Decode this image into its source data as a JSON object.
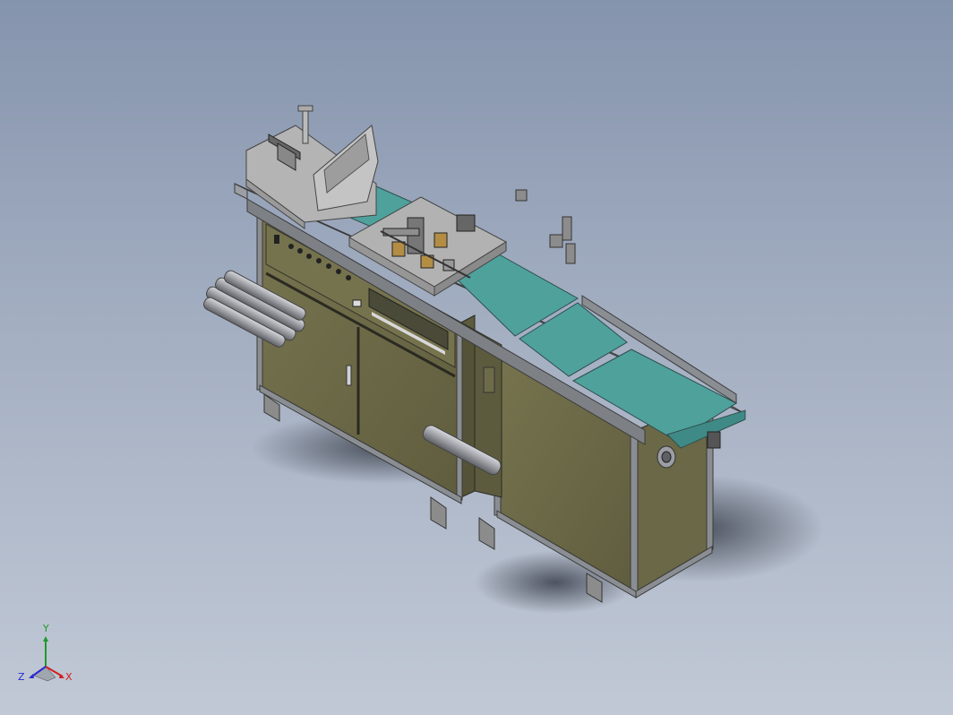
{
  "viewport": {
    "background_top": "#8594ad",
    "background_bottom": "#c1c9d6"
  },
  "model": {
    "frame_color": "#6b6948",
    "belt_color": "#4fa19c",
    "sheet_metal_color": "#b4b4b4",
    "aluminum_profile_color": "#8a8e93"
  },
  "triad": {
    "x_label": "X",
    "y_label": "Y",
    "z_label": "Z",
    "x_color": "#d21e1e",
    "y_color": "#1e9a2a",
    "z_color": "#2a2ad2"
  }
}
